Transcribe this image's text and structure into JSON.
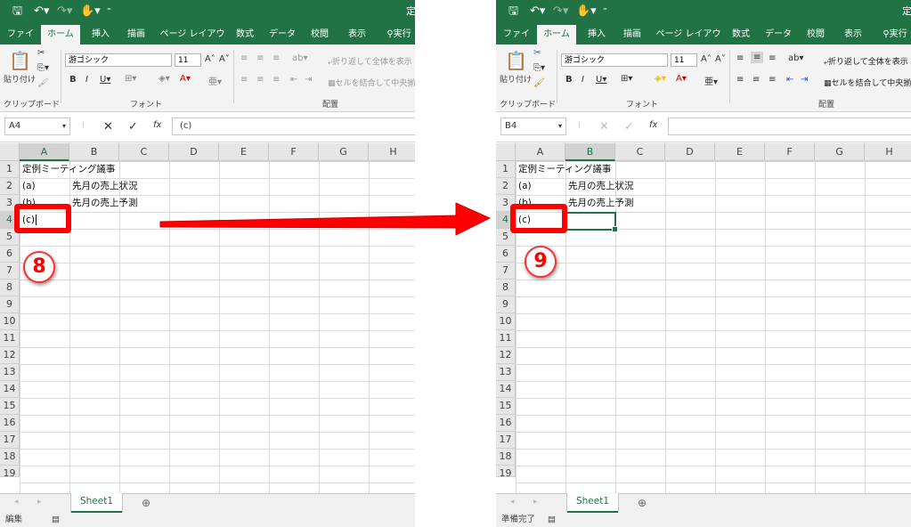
{
  "left": {
    "title_partial": "定",
    "tabs": [
      "ファイル",
      "ホーム",
      "挿入",
      "描画",
      "ページ レイアウト",
      "数式",
      "データ",
      "校閲",
      "表示",
      "実行"
    ],
    "active_tab": "ホーム",
    "font_name": "游ゴシック",
    "font_size": "11",
    "paste_label": "貼り付け",
    "clipboard_label": "クリップボード",
    "font_group_label": "フォント",
    "alignment_label": "配置",
    "wrap_text": "折り返して全体を表示",
    "merge_center": "セルを結合して中央揃",
    "name_box": "A4",
    "formula": "(c)",
    "columns": [
      "A",
      "B",
      "C",
      "D",
      "E",
      "F",
      "G",
      "H"
    ],
    "rows": [
      "1",
      "2",
      "3",
      "4",
      "5",
      "6",
      "7",
      "8",
      "9",
      "10",
      "11",
      "12",
      "13",
      "14",
      "15",
      "16",
      "17",
      "18",
      "19"
    ],
    "cells": {
      "a1": "定例ミーティング議事",
      "a2": "(a)",
      "b2": "先月の売上状況",
      "a3": "(b)",
      "b3": "先月の売上予測",
      "a4": "(c)"
    },
    "sheet_tab": "Sheet1",
    "status": "編集",
    "step": "8"
  },
  "right": {
    "title_partial": "定",
    "tabs": [
      "ファイル",
      "ホーム",
      "挿入",
      "描画",
      "ページ レイアウト",
      "数式",
      "データ",
      "校閲",
      "表示",
      "実行"
    ],
    "active_tab": "ホーム",
    "font_name": "游ゴシック",
    "font_size": "11",
    "paste_label": "貼り付け",
    "clipboard_label": "クリップボード",
    "font_group_label": "フォント",
    "alignment_label": "配置",
    "wrap_text": "折り返して全体を表示",
    "merge_center": "セルを結合して中央揃",
    "name_box": "B4",
    "formula": "",
    "columns": [
      "A",
      "B",
      "C",
      "D",
      "E",
      "F",
      "G",
      "H"
    ],
    "rows": [
      "1",
      "2",
      "3",
      "4",
      "5",
      "6",
      "7",
      "8",
      "9",
      "10",
      "11",
      "12",
      "13",
      "14",
      "15",
      "16",
      "17",
      "18",
      "19"
    ],
    "cells": {
      "a1": "定例ミーティング議事",
      "a2": "(a)",
      "b2": "先月の売上状況",
      "a3": "(b)",
      "b3": "先月の売上予測",
      "a4": "(c)"
    },
    "sheet_tab": "Sheet1",
    "status": "準備完了",
    "step": "9"
  },
  "colors": {
    "excel_green": "#217346",
    "annotation_red": "#ff0000"
  },
  "icons": [
    "save-icon",
    "undo-icon",
    "redo-icon",
    "touch-mode-icon",
    "customize-qat-icon",
    "lightbulb-icon",
    "paste-icon",
    "cut-icon",
    "copy-icon",
    "format-painter-icon",
    "bold-icon",
    "italic-icon",
    "underline-icon",
    "border-icon",
    "fill-color-icon",
    "font-color-icon",
    "cancel-icon",
    "enter-icon",
    "function-icon",
    "add-sheet-icon",
    "macro-record-icon"
  ]
}
